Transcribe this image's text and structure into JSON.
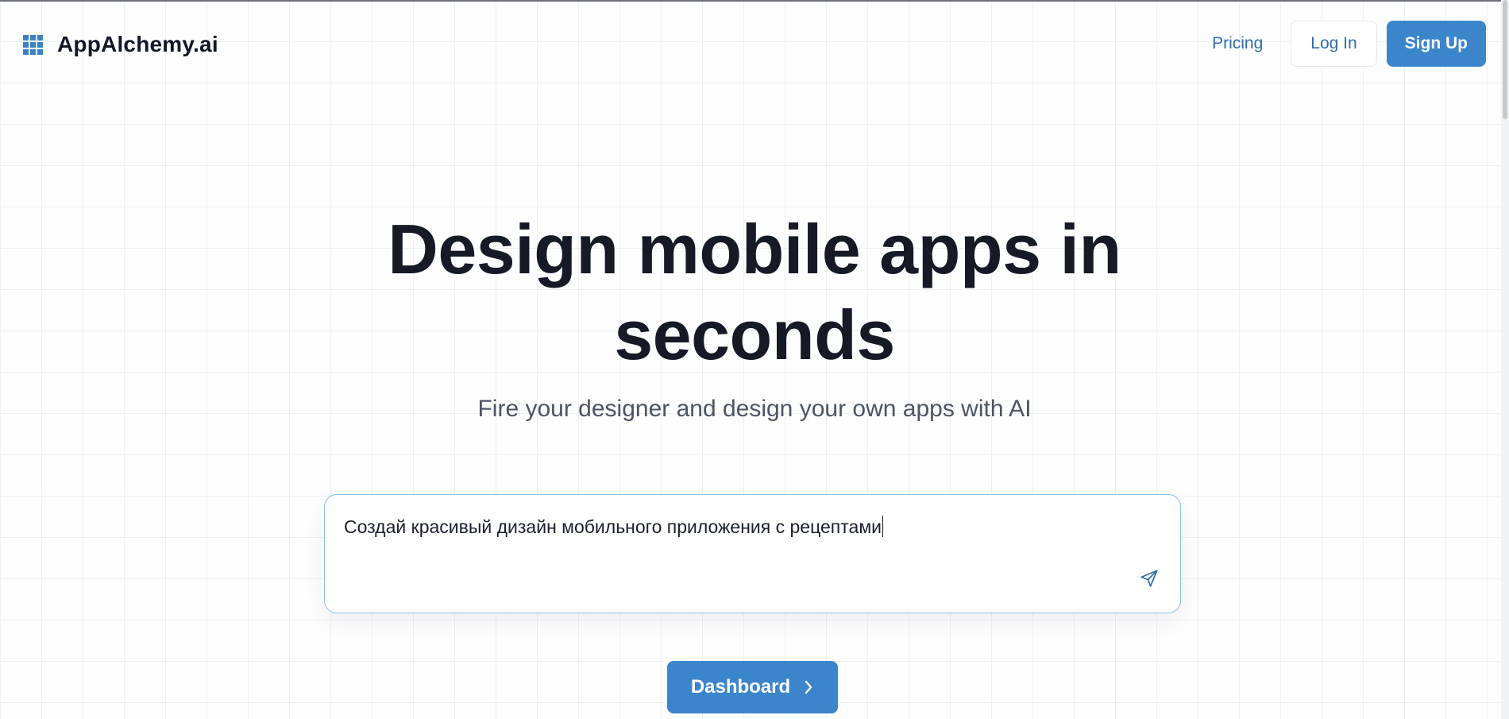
{
  "header": {
    "brand": "AppAlchemy.ai",
    "nav": {
      "pricing": "Pricing",
      "login": "Log In",
      "signup": "Sign Up"
    },
    "logo_icon": "grid-icon"
  },
  "hero": {
    "title_line1": "Design mobile apps in",
    "title_line2": "seconds",
    "subtitle": "Fire your designer and design your own apps with AI"
  },
  "prompt": {
    "value": "Создай красивый дизайн мобильного приложения с рецептами",
    "send_icon": "send-icon"
  },
  "cta": {
    "dashboard": "Dashboard"
  },
  "colors": {
    "accent": "#3b85cb",
    "link": "#2f6ea8",
    "title": "#151a26"
  }
}
